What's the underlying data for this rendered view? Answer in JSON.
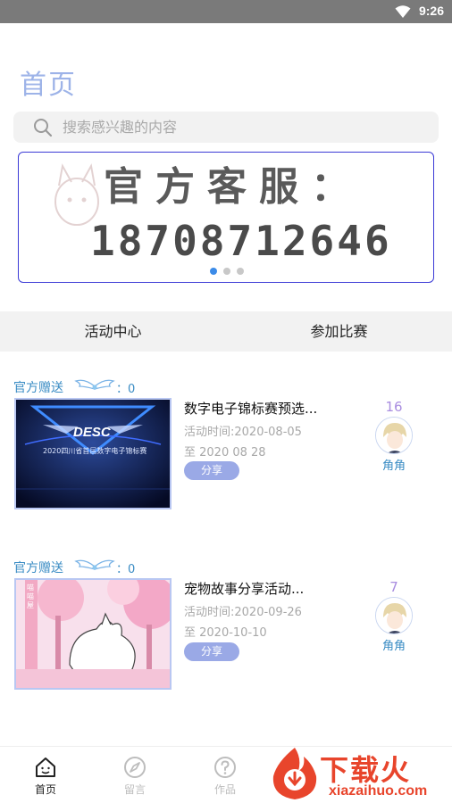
{
  "status_bar": {
    "time": "9:26"
  },
  "page_title": "首页",
  "search": {
    "placeholder": "搜索感兴趣的内容"
  },
  "banner": {
    "line1": "官方客服：",
    "line2": "18708712646",
    "slide_count": 3,
    "active_slide": 1
  },
  "tabs": [
    {
      "label": "活动中心"
    },
    {
      "label": "参加比赛"
    }
  ],
  "cards": [
    {
      "tag": "官方赠送",
      "wings_count": "：0",
      "title": "数字电子锦标赛预选...",
      "activity_time": "活动时间:2020-08-05",
      "end_time": "至 2020 08 28",
      "share_label": "分享",
      "count": "16",
      "author": "角角",
      "thumb": {
        "brand": "DESC",
        "caption": "2020四川省首届数字电子锦标赛"
      }
    },
    {
      "tag": "官方赠送",
      "wings_count": "：0",
      "title": " 宠物故事分享活动...",
      "activity_time": "活动时间:2020-09-26",
      "end_time": "至 2020-10-10",
      "share_label": "分享",
      "count": "7",
      "author": "角角",
      "thumb": {
        "caption": "喵喵屋"
      }
    }
  ],
  "bottom_nav": [
    {
      "label": "首页",
      "icon": "home-icon",
      "active": true
    },
    {
      "label": "留言",
      "icon": "compass-icon",
      "active": false
    },
    {
      "label": "作品",
      "icon": "question-icon",
      "active": false
    }
  ],
  "watermark": {
    "text": "下载火",
    "site": "xiazaihuo.com"
  },
  "colors": {
    "accent": "#9db3e8",
    "link": "#3a8cc4",
    "share_button": "#9aa9e6",
    "banner_border": "#3b3ad6",
    "watermark": "#e8452c"
  }
}
